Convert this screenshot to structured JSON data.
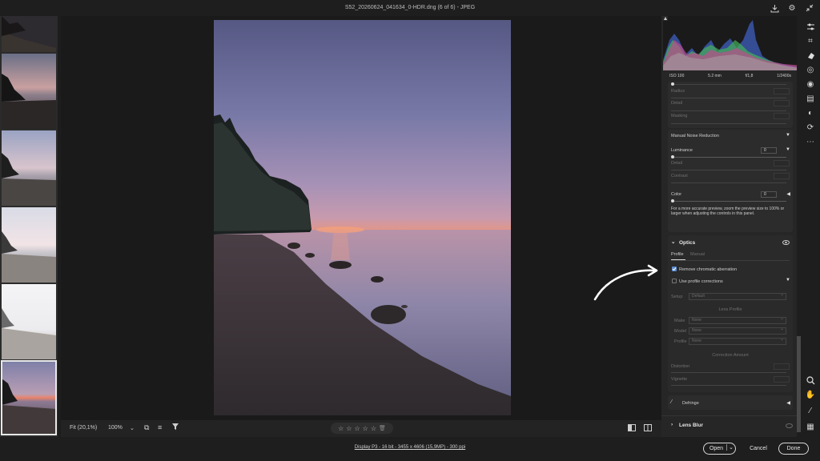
{
  "window": {
    "title": "S52_20260624_041634_0-HDR.dng (6 of 6)  -  JPEG",
    "icons": [
      "export-icon",
      "gear-icon",
      "collapse-icon"
    ]
  },
  "histogram": {
    "iso": "ISO 100",
    "focal": "5.2 mm",
    "aperture": "f/1,8",
    "shutter": "1/2400s"
  },
  "detail": {
    "labels": [
      "Radius",
      "Detail",
      "Masking"
    ]
  },
  "noise": {
    "title": "Manual Noise Reduction",
    "luminance_label": "Luminance",
    "luminance_value": "0",
    "detail_label": "Detail",
    "contrast_label": "Contrast",
    "color_label": "Color",
    "color_value": "0",
    "note": "For a more accurate preview, zoom the preview size to 100% or larger when adjusting the controls in this panel."
  },
  "optics": {
    "title": "Optics",
    "tab_profile": "Profile",
    "tab_manual": "Manual",
    "remove_ca_label": "Remove chromatic aberration",
    "remove_ca_checked": true,
    "use_profile_label": "Use profile corrections",
    "setup_label": "Setup",
    "setup_value": "Default",
    "lens_profile_label": "Lens Profile",
    "make_label": "Make",
    "make_value": "None",
    "model_label": "Model",
    "model_value": "None",
    "profile_label": "Profile",
    "profile_value": "None",
    "correction_amount_label": "Correction Amount",
    "distortion_label": "Distortion",
    "vignette_label": "Vignette",
    "defringe_label": "Defringe"
  },
  "lens_blur": {
    "title": "Lens Blur"
  },
  "canvas_bar": {
    "zoom_fit": "Fit (20,1%)",
    "zoom_100": "100%"
  },
  "footer": {
    "info": "Display P3 - 16 bit - 3455 x 4606 (15,9MP) - 300 ppi",
    "open": "Open",
    "cancel": "Cancel",
    "done": "Done"
  }
}
